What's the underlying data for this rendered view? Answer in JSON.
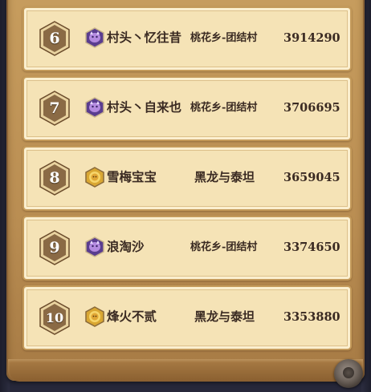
{
  "leaderboard": {
    "rows": [
      {
        "rank": "6",
        "name": "村头丶忆往昔",
        "server": "桃花乡-团结村",
        "score": "3914290",
        "badge": "purple-beast-icon"
      },
      {
        "rank": "7",
        "name": "村头丶自来也",
        "server": "桃花乡-团结村",
        "score": "3706695",
        "badge": "purple-beast-icon"
      },
      {
        "rank": "8",
        "name": "雪梅宝宝",
        "server": "黑龙与泰坦",
        "score": "3659045",
        "badge": "gold-lion-icon"
      },
      {
        "rank": "9",
        "name": "浪淘沙",
        "server": "桃花乡-团结村",
        "score": "3374650",
        "badge": "purple-beast-icon"
      },
      {
        "rank": "10",
        "name": "烽火不贰",
        "server": "黑龙与泰坦",
        "score": "3353880",
        "badge": "gold-lion-icon"
      }
    ]
  },
  "colors": {
    "row_bg": "#f5e3b6",
    "rank_hex": "#8a6a45",
    "text": "#3a2a22",
    "purple_badge": "#6b46a8",
    "gold_badge": "#d9a732"
  }
}
